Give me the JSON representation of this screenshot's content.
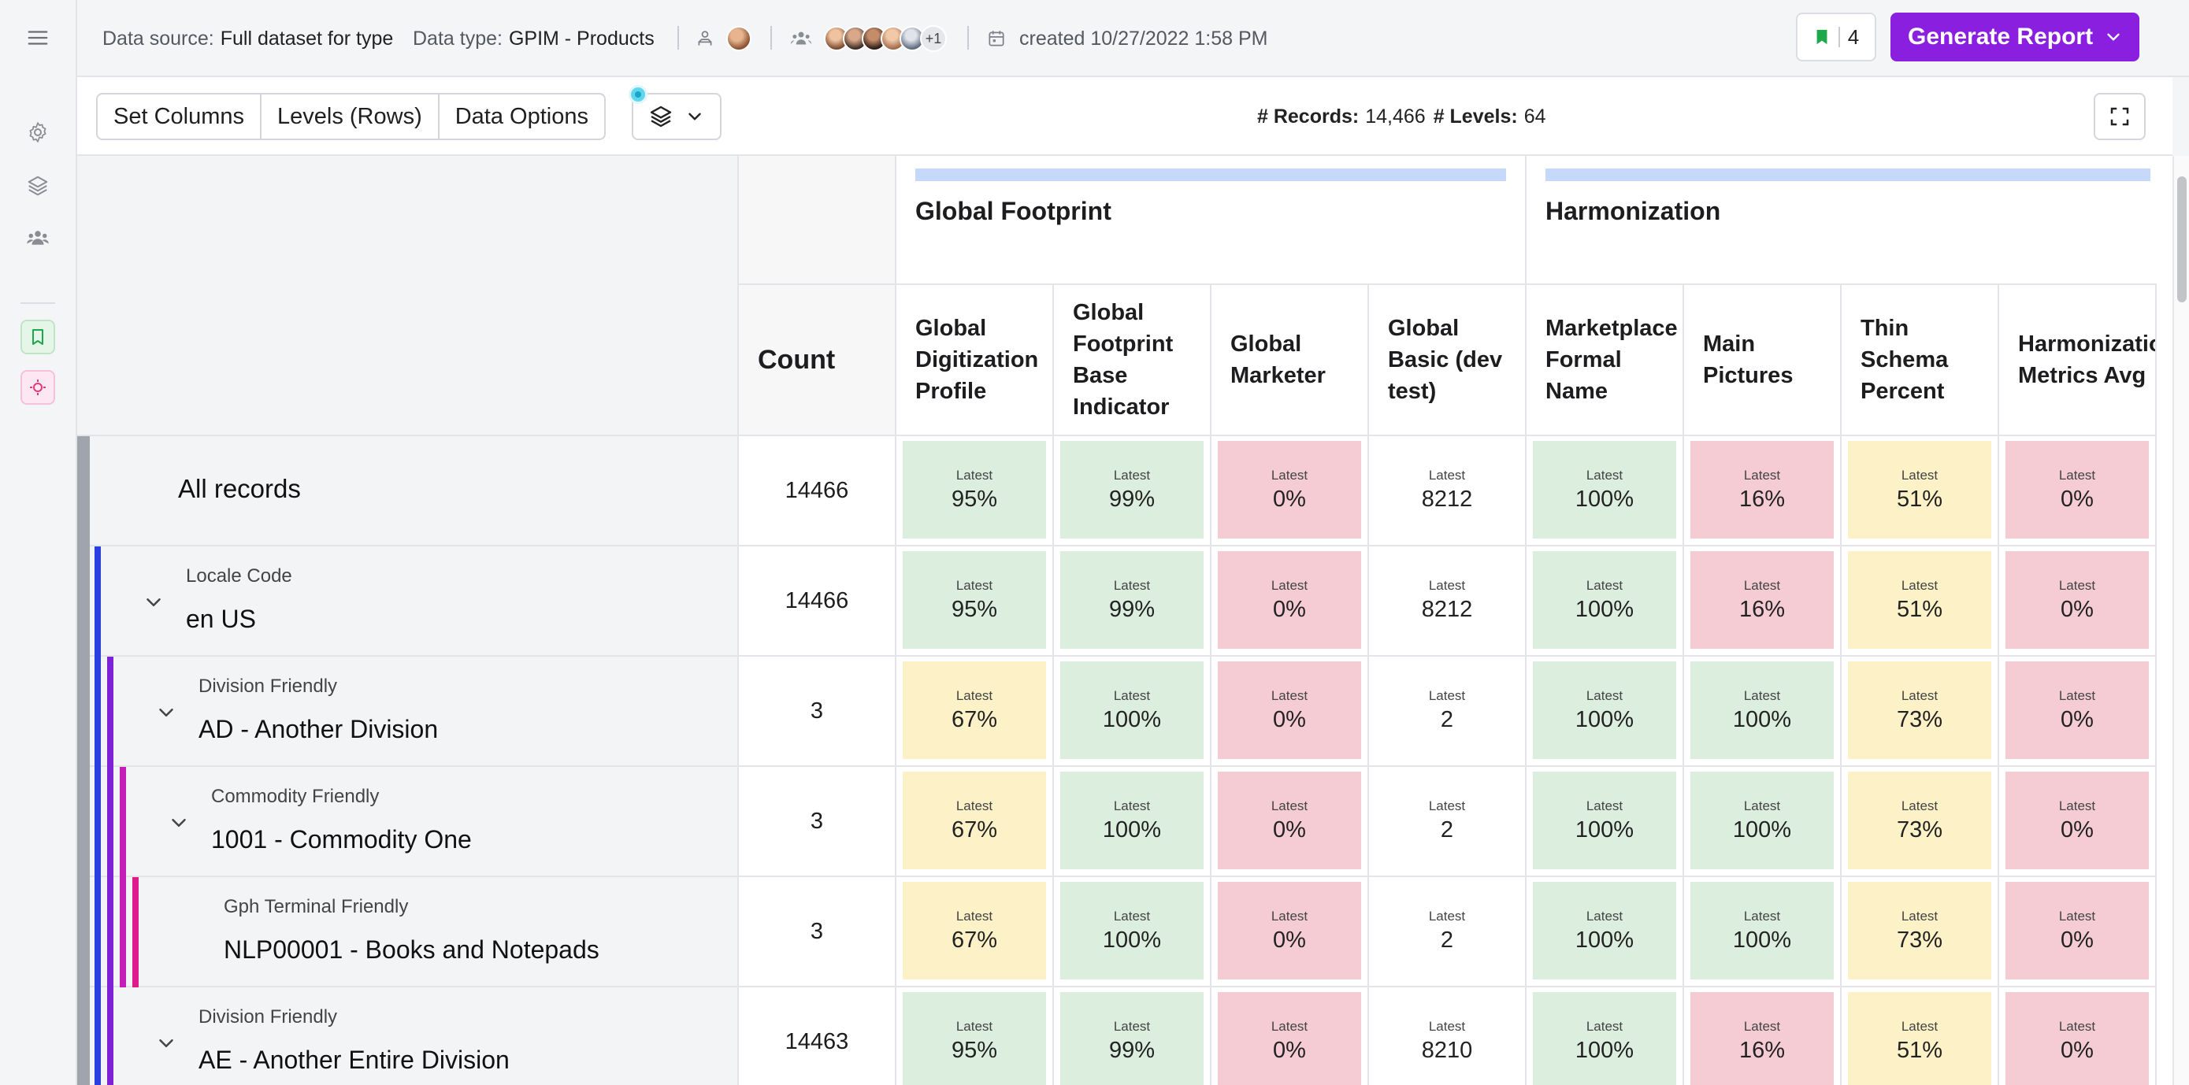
{
  "topbar": {
    "data_source_label": "Data source:",
    "data_source_value": "Full dataset for type",
    "data_type_label": "Data type:",
    "data_type_value": "GPIM - Products",
    "users_more": "+1",
    "created": "created 10/27/2022 1:58 PM",
    "bookmark_count": "4",
    "generate_report": "Generate Report"
  },
  "toolbar": {
    "set_columns": "Set Columns",
    "levels_rows": "Levels (Rows)",
    "data_options": "Data Options",
    "records_label": "# Records:",
    "records_value": "14,466",
    "levels_label": "# Levels:",
    "levels_value": "64"
  },
  "grid": {
    "count_header": "Count",
    "groups": [
      {
        "label": "Global Footprint"
      },
      {
        "label": "Harmonization"
      }
    ],
    "columns": [
      "Global\nDigitization\nProfile",
      "Global\nFootprint\nBase\nIndicator",
      "Global\nMarketer",
      "Global\nBasic (dev\ntest)",
      "Marketplace\nFormal\nName",
      "Main\nPictures",
      "Thin\nSchema\nPercent",
      "Harmonizatio\nMetrics Avg"
    ],
    "tile_caption": "Latest",
    "rows": [
      {
        "level": "",
        "name": "All records",
        "count": "14466",
        "values": [
          "95%",
          "99%",
          "0%",
          "8212",
          "100%",
          "16%",
          "51%",
          "0%"
        ],
        "states": [
          "g",
          "g",
          "r",
          "w",
          "g",
          "r",
          "y",
          "r"
        ]
      },
      {
        "level": "Locale Code",
        "name": "en US",
        "count": "14466",
        "values": [
          "95%",
          "99%",
          "0%",
          "8212",
          "100%",
          "16%",
          "51%",
          "0%"
        ],
        "states": [
          "g",
          "g",
          "r",
          "w",
          "g",
          "r",
          "y",
          "r"
        ]
      },
      {
        "level": "Division Friendly",
        "name": "AD - Another Division",
        "count": "3",
        "values": [
          "67%",
          "100%",
          "0%",
          "2",
          "100%",
          "100%",
          "73%",
          "0%"
        ],
        "states": [
          "y",
          "g",
          "r",
          "w",
          "g",
          "g",
          "y",
          "r"
        ]
      },
      {
        "level": "Commodity Friendly",
        "name": "1001 - Commodity One",
        "count": "3",
        "values": [
          "67%",
          "100%",
          "0%",
          "2",
          "100%",
          "100%",
          "73%",
          "0%"
        ],
        "states": [
          "y",
          "g",
          "r",
          "w",
          "g",
          "g",
          "y",
          "r"
        ]
      },
      {
        "level": "Gph Terminal Friendly",
        "name": "NLP00001 - Books and Notepads",
        "count": "3",
        "values": [
          "67%",
          "100%",
          "0%",
          "2",
          "100%",
          "100%",
          "73%",
          "0%"
        ],
        "states": [
          "y",
          "g",
          "r",
          "w",
          "g",
          "g",
          "y",
          "r"
        ]
      },
      {
        "level": "Division Friendly",
        "name": "AE - Another Entire Division",
        "count": "14463",
        "values": [
          "95%",
          "99%",
          "0%",
          "8210",
          "100%",
          "16%",
          "51%",
          "0%"
        ],
        "states": [
          "g",
          "g",
          "r",
          "w",
          "g",
          "r",
          "y",
          "r"
        ]
      }
    ]
  },
  "colors": {
    "primary": "#8a1fe0",
    "tile_green": "#dcefdf",
    "tile_red": "#f5ccd3",
    "tile_yellow": "#fcf1c7",
    "group_bar": "#c7d9fb",
    "stripe_gray": "#a0a4ad",
    "stripe_blue": "#2a3fe0",
    "stripe_purple": "#7e22d8",
    "stripe_magenta": "#c41db8",
    "stripe_pink": "#e0198c"
  }
}
